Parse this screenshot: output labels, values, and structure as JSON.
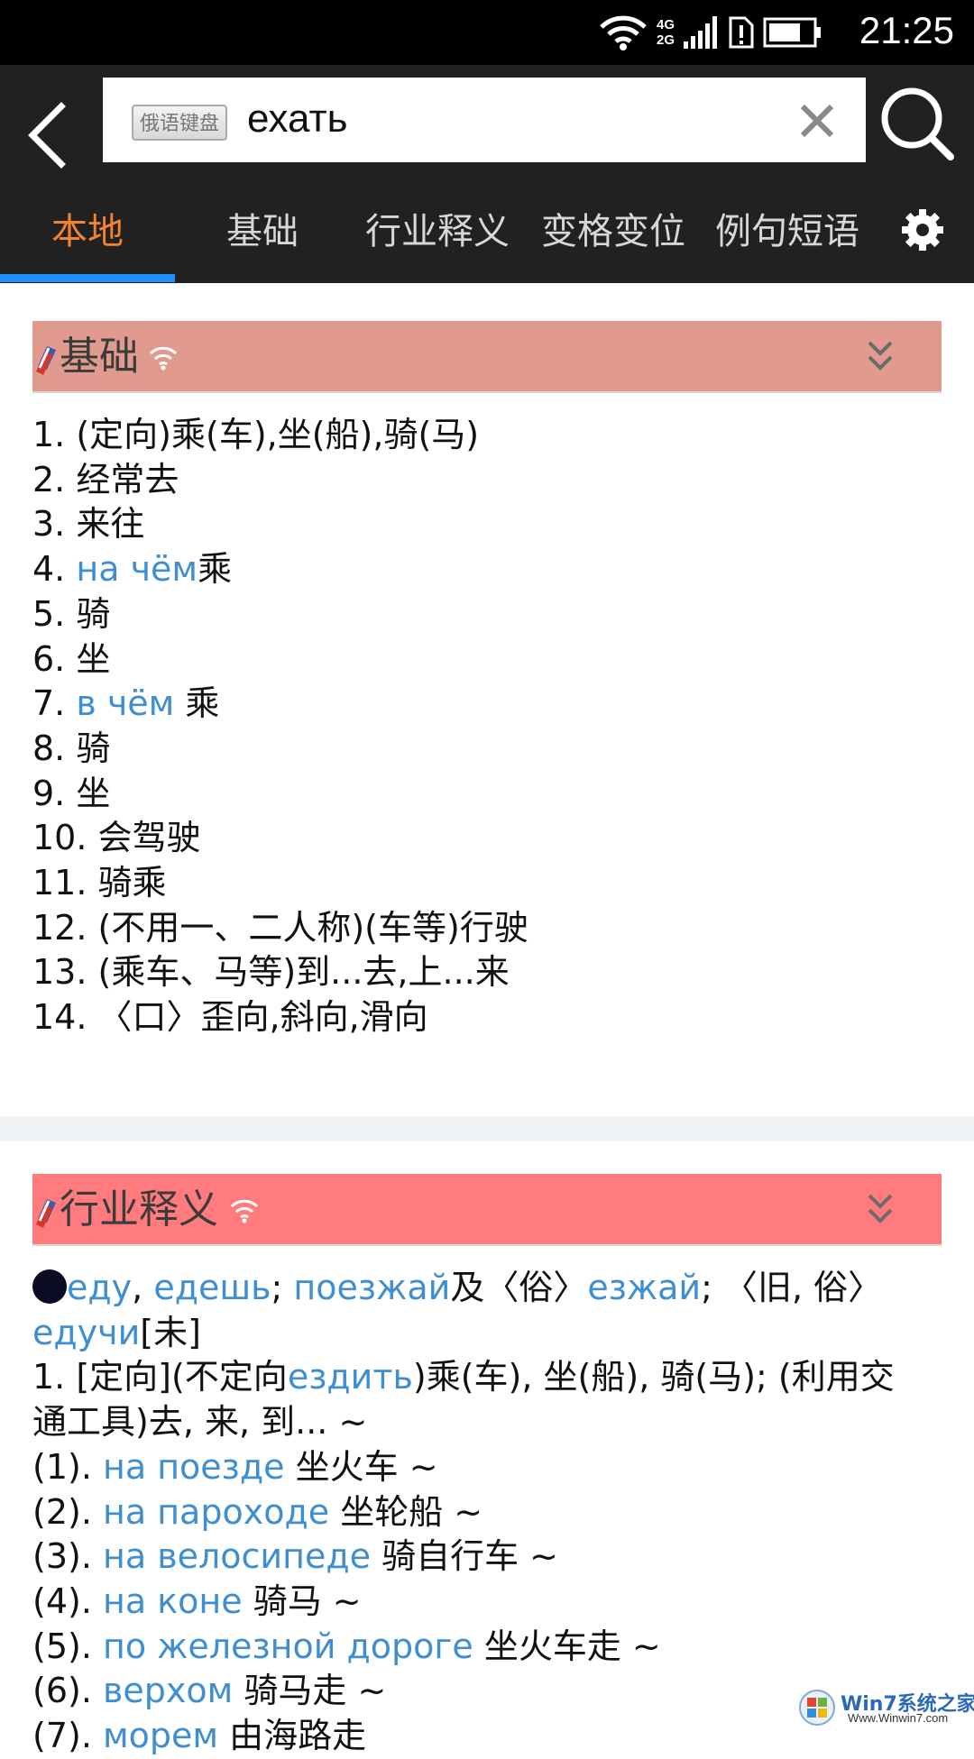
{
  "status_bar": {
    "time": "21:25",
    "network_top": "4G",
    "network_bottom": "2G",
    "icons": [
      "wifi-icon",
      "signal-icon",
      "sim-icon",
      "battery-icon"
    ]
  },
  "search": {
    "keyboard_badge": "俄语键盘",
    "query": "ехать",
    "icons": [
      "back-arrow-icon",
      "clear-icon",
      "search-icon"
    ]
  },
  "tabs": [
    {
      "label": "本地",
      "active": true
    },
    {
      "label": "基础",
      "active": false
    },
    {
      "label": "行业释义",
      "active": false
    },
    {
      "label": "变格变位",
      "active": false
    },
    {
      "label": "例句短语",
      "active": false
    }
  ],
  "colors": {
    "accent_tab": "#f3832f",
    "tab_indicator": "#1e90ff",
    "header_bg": "#212121",
    "section_basic_bg": "#e09a8e",
    "section_industry_bg": "#ff7b7d",
    "russian_link": "#3f8ed0"
  },
  "sections": {
    "basic": {
      "title": "基础",
      "items": [
        {
          "num": "1.",
          "ru": "",
          "zh": " (定向)乘(车),坐(船),骑(马)"
        },
        {
          "num": "2.",
          "ru": "",
          "zh": " 经常去"
        },
        {
          "num": "3.",
          "ru": "",
          "zh": " 来往"
        },
        {
          "num": "4.",
          "ru": "на чём",
          "zh": "乘"
        },
        {
          "num": "5.",
          "ru": "",
          "zh": " 骑"
        },
        {
          "num": "6.",
          "ru": "",
          "zh": " 坐"
        },
        {
          "num": "7.",
          "ru": "в чём",
          "zh": "  乘"
        },
        {
          "num": "8.",
          "ru": "",
          "zh": " 骑"
        },
        {
          "num": "9.",
          "ru": "",
          "zh": " 坐"
        },
        {
          "num": "10.",
          "ru": "",
          "zh": " 会驾驶"
        },
        {
          "num": "11.",
          "ru": "",
          "zh": " 骑乘"
        },
        {
          "num": "12.",
          "ru": "",
          "zh": " (不用一、二人称)(车等)行驶"
        },
        {
          "num": "13.",
          "ru": "",
          "zh": " (乘车、马等)到...去,上...来"
        },
        {
          "num": "14.",
          "ru": "",
          "zh": " 〈口〉歪向,斜向,滑向"
        }
      ]
    },
    "industry": {
      "title": "行业释义",
      "forms": {
        "f1": "еду",
        "sep1": ", ",
        "f2": "едешь",
        "sep2": "; ",
        "f3": "поезжай",
        "mid": "及〈俗〉",
        "f4": "езжай",
        "tail": "; 〈旧, 俗〉",
        "f5": "едучи",
        "aspect": "[未]"
      },
      "def1": {
        "start": "1. [定向](不定向",
        "ru": "ездить",
        "end": ")乘(车), 坐(船), 骑(马); (利用交",
        "line2": "通工具)去, 来, 到... ~"
      },
      "examples": [
        {
          "num": "(1). ",
          "ru": "на поезде",
          "zh": " 坐火车 ~"
        },
        {
          "num": "(2). ",
          "ru": "на пароходе",
          "zh": " 坐轮船 ~"
        },
        {
          "num": "(3). ",
          "ru": "на велосипеде",
          "zh": " 骑自行车 ~"
        },
        {
          "num": "(4). ",
          "ru": "на коне",
          "zh": " 骑马 ~"
        },
        {
          "num": "(5). ",
          "ru": "по железной дороге",
          "zh": " 坐火车走 ~"
        },
        {
          "num": "(6). ",
          "ru": "верхом",
          "zh": " 骑马走 ~"
        },
        {
          "num": "(7). ",
          "ru": "морем",
          "zh": " 由海路走"
        }
      ]
    }
  },
  "watermark": {
    "title": "Win7系统之家",
    "url": "Www.Winwin7.com"
  }
}
